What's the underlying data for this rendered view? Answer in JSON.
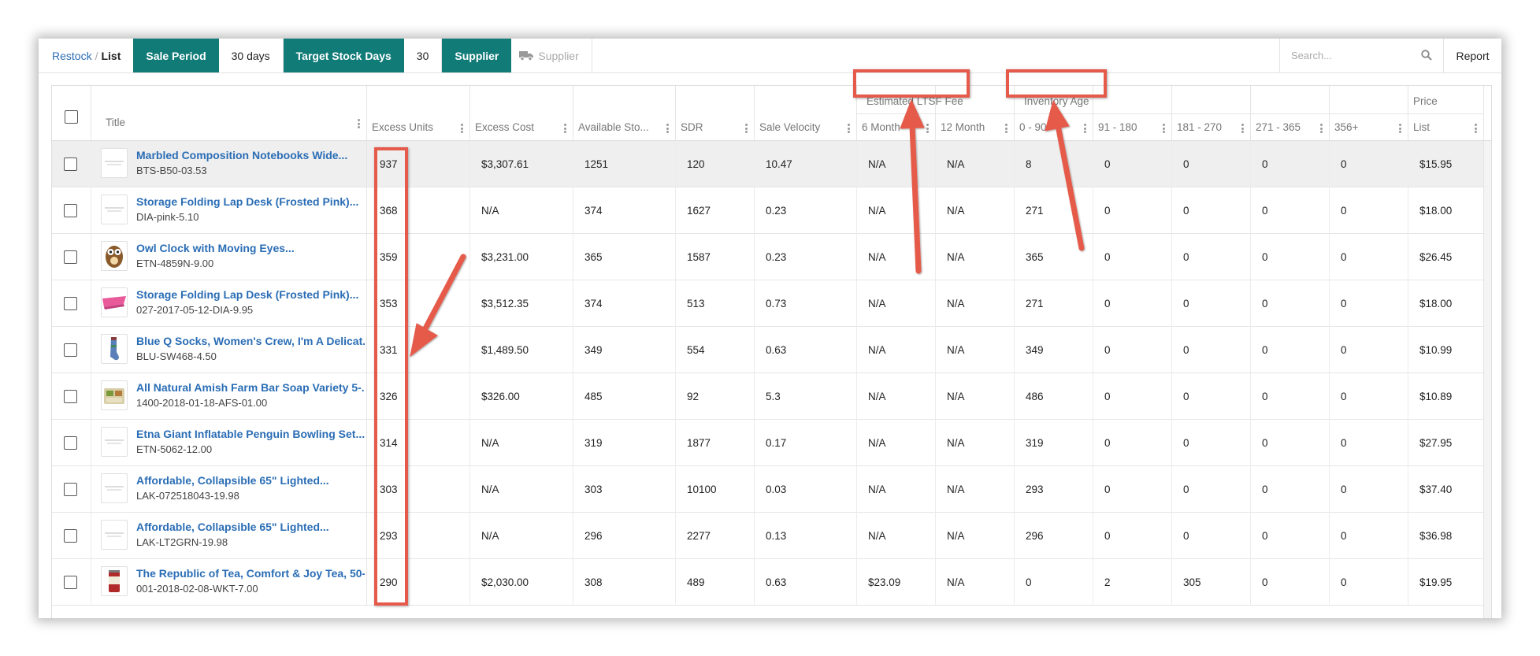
{
  "toolbar": {
    "breadcrumb_link": "Restock",
    "breadcrumb_sep": "/",
    "breadcrumb_current": "List",
    "sale_period_label": "Sale Period",
    "sale_period_value": "30 days",
    "target_stock_label": "Target Stock Days",
    "target_stock_value": "30",
    "supplier_label": "Supplier",
    "supplier_placeholder": "Supplier",
    "search_placeholder": "Search...",
    "report_label": "Report"
  },
  "table": {
    "group_headers": {
      "ltsf": "Estimated LTSF Fee",
      "inventory_age": "Inventory Age",
      "price": "Price"
    },
    "columns": {
      "title": "Title",
      "excess_units": "Excess Units",
      "excess_cost": "Excess Cost",
      "available_stock": "Available Sto...",
      "sdr": "SDR",
      "sale_velocity": "Sale Velocity",
      "ltsf_6": "6 Month",
      "ltsf_12": "12 Month",
      "age_0_90": "0 - 90",
      "age_91_180": "91 - 180",
      "age_181_270": "181 - 270",
      "age_271_365": "271 - 365",
      "age_356": "356+",
      "price_list": "List"
    },
    "rows": [
      {
        "title": "Marbled Composition Notebooks Wide...",
        "sku": "BTS-B50-03.53",
        "excess_units": "937",
        "excess_cost": "$3,307.61",
        "available": "1251",
        "sdr": "120",
        "velocity": "10.47",
        "ltsf6": "N/A",
        "ltsf12": "N/A",
        "a0": "8",
        "a91": "0",
        "a181": "0",
        "a271": "0",
        "a356": "0",
        "price": "$15.95",
        "thumb": "placeholder-icon"
      },
      {
        "title": "Storage Folding Lap Desk (Frosted Pink)...",
        "sku": "DIA-pink-5.10",
        "excess_units": "368",
        "excess_cost": "N/A",
        "available": "374",
        "sdr": "1627",
        "velocity": "0.23",
        "ltsf6": "N/A",
        "ltsf12": "N/A",
        "a0": "271",
        "a91": "0",
        "a181": "0",
        "a271": "0",
        "a356": "0",
        "price": "$18.00",
        "thumb": "placeholder-icon"
      },
      {
        "title": "Owl Clock with Moving Eyes...",
        "sku": "ETN-4859N-9.00",
        "excess_units": "359",
        "excess_cost": "$3,231.00",
        "available": "365",
        "sdr": "1587",
        "velocity": "0.23",
        "ltsf6": "N/A",
        "ltsf12": "N/A",
        "a0": "365",
        "a91": "0",
        "a181": "0",
        "a271": "0",
        "a356": "0",
        "price": "$26.45",
        "thumb": "owl-clock-icon"
      },
      {
        "title": "Storage Folding Lap Desk (Frosted Pink)...",
        "sku": "027-2017-05-12-DIA-9.95",
        "excess_units": "353",
        "excess_cost": "$3,512.35",
        "available": "374",
        "sdr": "513",
        "velocity": "0.73",
        "ltsf6": "N/A",
        "ltsf12": "N/A",
        "a0": "271",
        "a91": "0",
        "a181": "0",
        "a271": "0",
        "a356": "0",
        "price": "$18.00",
        "thumb": "pink-lap-desk-icon"
      },
      {
        "title": "Blue Q Socks, Women's Crew, I'm A Delicat...",
        "sku": "BLU-SW468-4.50",
        "excess_units": "331",
        "excess_cost": "$1,489.50",
        "available": "349",
        "sdr": "554",
        "velocity": "0.63",
        "ltsf6": "N/A",
        "ltsf12": "N/A",
        "a0": "349",
        "a91": "0",
        "a181": "0",
        "a271": "0",
        "a356": "0",
        "price": "$10.99",
        "thumb": "sock-icon"
      },
      {
        "title": "All Natural Amish Farm Bar Soap Variety 5-...",
        "sku": "1400-2018-01-18-AFS-01.00",
        "excess_units": "326",
        "excess_cost": "$326.00",
        "available": "485",
        "sdr": "92",
        "velocity": "5.3",
        "ltsf6": "N/A",
        "ltsf12": "N/A",
        "a0": "486",
        "a91": "0",
        "a181": "0",
        "a271": "0",
        "a356": "0",
        "price": "$10.89",
        "thumb": "soap-icon"
      },
      {
        "title": "Etna Giant Inflatable Penguin Bowling Set...",
        "sku": "ETN-5062-12.00",
        "excess_units": "314",
        "excess_cost": "N/A",
        "available": "319",
        "sdr": "1877",
        "velocity": "0.17",
        "ltsf6": "N/A",
        "ltsf12": "N/A",
        "a0": "319",
        "a91": "0",
        "a181": "0",
        "a271": "0",
        "a356": "0",
        "price": "$27.95",
        "thumb": "placeholder-icon"
      },
      {
        "title": "Affordable, Collapsible 65\" Lighted...",
        "sku": "LAK-072518043-19.98",
        "excess_units": "303",
        "excess_cost": "N/A",
        "available": "303",
        "sdr": "10100",
        "velocity": "0.03",
        "ltsf6": "N/A",
        "ltsf12": "N/A",
        "a0": "293",
        "a91": "0",
        "a181": "0",
        "a271": "0",
        "a356": "0",
        "price": "$37.40",
        "thumb": "placeholder-icon"
      },
      {
        "title": "Affordable, Collapsible 65\" Lighted...",
        "sku": "LAK-LT2GRN-19.98",
        "excess_units": "293",
        "excess_cost": "N/A",
        "available": "296",
        "sdr": "2277",
        "velocity": "0.13",
        "ltsf6": "N/A",
        "ltsf12": "N/A",
        "a0": "296",
        "a91": "0",
        "a181": "0",
        "a271": "0",
        "a356": "0",
        "price": "$36.98",
        "thumb": "placeholder-icon"
      },
      {
        "title": "The Republic of Tea, Comfort & Joy Tea, 50-...",
        "sku": "001-2018-02-08-WKT-7.00",
        "excess_units": "290",
        "excess_cost": "$2,030.00",
        "available": "308",
        "sdr": "489",
        "velocity": "0.63",
        "ltsf6": "$23.09",
        "ltsf12": "N/A",
        "a0": "0",
        "a91": "2",
        "a181": "305",
        "a271": "0",
        "a356": "0",
        "price": "$19.95",
        "thumb": "tea-tin-icon"
      }
    ]
  },
  "colors": {
    "accent": "#117b78",
    "link": "#2a6db5",
    "annotation": "#e55a4a",
    "highlight_row": "#efefef"
  }
}
